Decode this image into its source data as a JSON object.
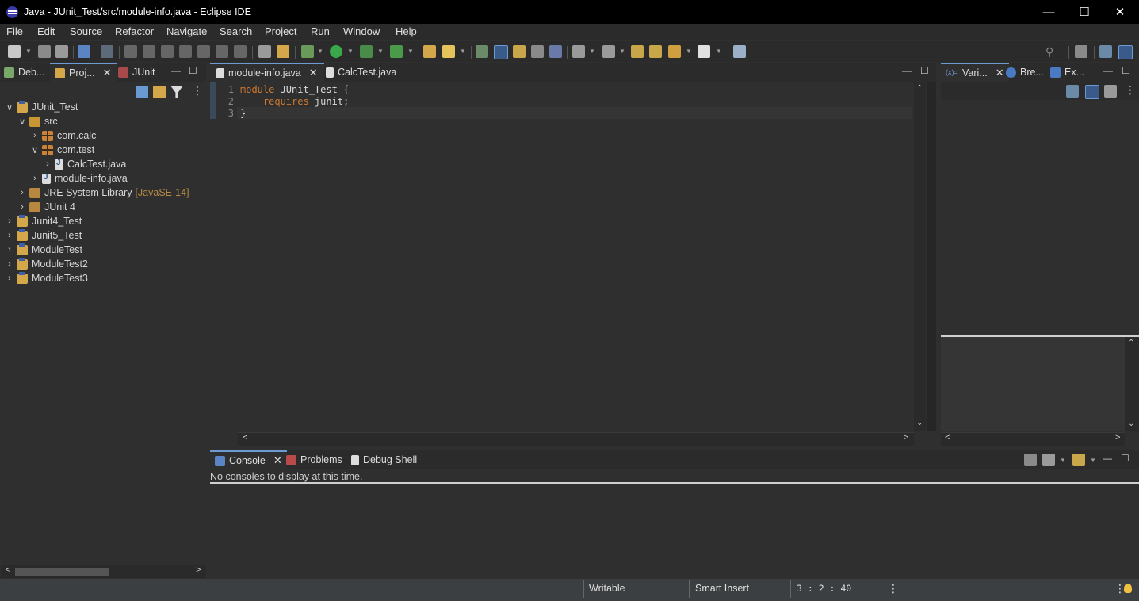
{
  "window": {
    "title": "Java - JUnit_Test/src/module-info.java - Eclipse IDE"
  },
  "menu": [
    "File",
    "Edit",
    "Source",
    "Refactor",
    "Navigate",
    "Search",
    "Project",
    "Run",
    "Window",
    "Help"
  ],
  "left_panel": {
    "tabs": [
      {
        "label": "Deb..."
      },
      {
        "label": "Proj..."
      },
      {
        "label": "JUnit"
      }
    ],
    "tree": [
      {
        "label": "JUnit_Test",
        "arrow": "∨"
      },
      {
        "label": "src",
        "arrow": "∨"
      },
      {
        "label": "com.calc",
        "arrow": "›"
      },
      {
        "label": "com.test",
        "arrow": "∨"
      },
      {
        "label": "CalcTest.java",
        "arrow": "›"
      },
      {
        "label": "module-info.java",
        "arrow": "›"
      },
      {
        "label": "JRE System Library",
        "decoration": "[JavaSE-14]",
        "arrow": "›"
      },
      {
        "label": "JUnit 4",
        "arrow": "›"
      },
      {
        "label": "Junit4_Test",
        "arrow": "›"
      },
      {
        "label": "Junit5_Test",
        "arrow": "›"
      },
      {
        "label": "ModuleTest",
        "arrow": "›"
      },
      {
        "label": "ModuleTest2",
        "arrow": "›"
      },
      {
        "label": "ModuleTest3",
        "arrow": "›"
      }
    ]
  },
  "editor": {
    "tabs": [
      {
        "label": "module-info.java"
      },
      {
        "label": "CalcTest.java"
      }
    ],
    "lines": [
      {
        "num": "1",
        "kw": "module",
        "rest": " JUnit_Test {"
      },
      {
        "num": "2",
        "kw": "    requires",
        "rest": " junit;"
      },
      {
        "num": "3",
        "kw": "",
        "rest": "}"
      }
    ]
  },
  "right_panel": {
    "tabs": [
      {
        "label": "Vari..."
      },
      {
        "label": "Bre..."
      },
      {
        "label": "Ex..."
      }
    ]
  },
  "bottom_panel": {
    "tabs": [
      {
        "label": "Console"
      },
      {
        "label": "Problems"
      },
      {
        "label": "Debug Shell"
      }
    ],
    "message": "No consoles to display at this time."
  },
  "status": {
    "writable": "Writable",
    "insert_mode": "Smart Insert",
    "position": "3 : 2 : 40"
  },
  "colors": {
    "accent": "#6c9bd2",
    "keyword": "#cc7832"
  }
}
